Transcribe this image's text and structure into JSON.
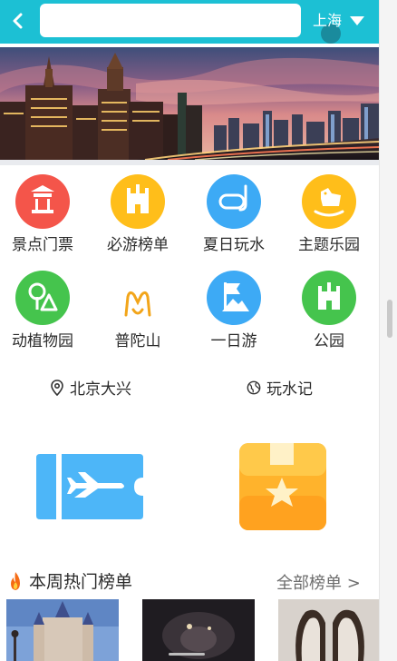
{
  "header": {
    "back_icon": "chevron-left-icon",
    "search_placeholder": "",
    "city": "上海"
  },
  "banner": {
    "slide_count": 2,
    "active_index": 0
  },
  "categories": [
    {
      "label": "景点门票",
      "icon": "pavilion-icon",
      "color": "#f4554a"
    },
    {
      "label": "必游榜单",
      "icon": "castle-icon",
      "color": "#ffbe1a"
    },
    {
      "label": "夏日玩水",
      "icon": "diving-mask-icon",
      "color": "#3daaf5"
    },
    {
      "label": "主题乐园",
      "icon": "rocking-horse-icon",
      "color": "#ffbe1a"
    },
    {
      "label": "动植物园",
      "icon": "tree-icon",
      "color": "#45c44d"
    },
    {
      "label": "普陀山",
      "icon": "mountain-logo-icon",
      "color": "#f2a51a"
    },
    {
      "label": "一日游",
      "icon": "flag-mountain-icon",
      "color": "#3daaf5"
    },
    {
      "label": "公园",
      "icon": "park-castle-icon",
      "color": "#45c44d"
    }
  ],
  "quick_links": [
    {
      "label": "北京大兴",
      "icon": "location-pin-icon"
    },
    {
      "label": "玩水记",
      "icon": "globe-icon"
    }
  ],
  "feature_cards": [
    {
      "icon": "flight-ticket-icon"
    },
    {
      "icon": "star-box-icon"
    }
  ],
  "hot_list": {
    "title": "本周热门榜单",
    "more": "全部榜单 >"
  },
  "colors": {
    "header_bg": "#1cc0d4"
  }
}
